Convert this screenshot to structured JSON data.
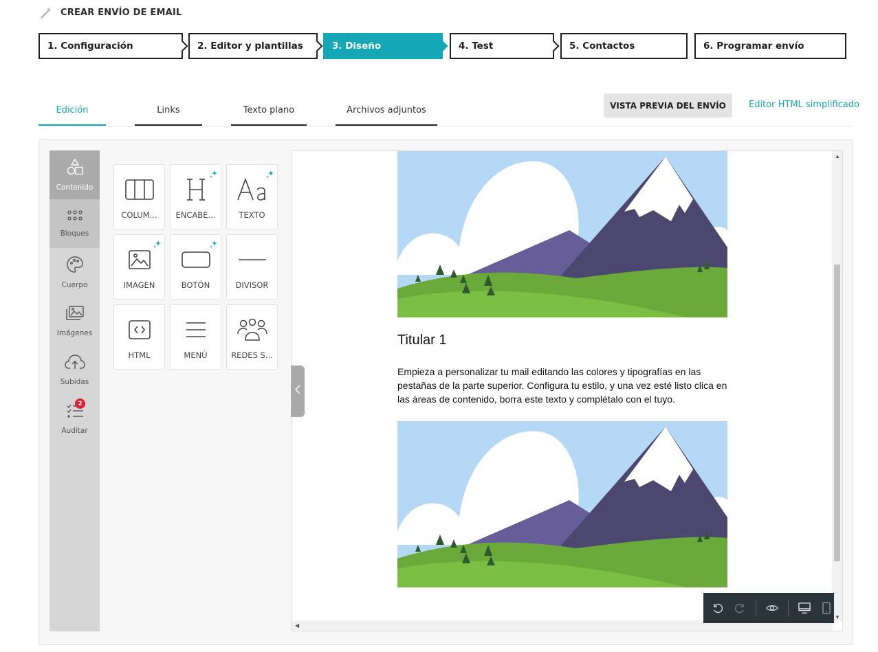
{
  "header": {
    "title": "CREAR ENVÍO DE EMAIL",
    "icon": "magic-wand-icon"
  },
  "steps": [
    {
      "label": "1. Configuración",
      "active": false
    },
    {
      "label": "2. Editor y plantillas",
      "active": false
    },
    {
      "label": "3. Diseño",
      "active": true
    },
    {
      "label": "4. Test",
      "active": false
    },
    {
      "label": "5. Contactos",
      "active": false
    },
    {
      "label": "6. Programar envío",
      "active": false
    }
  ],
  "tabs": [
    {
      "label": "Edición",
      "active": true
    },
    {
      "label": "Links",
      "active": false
    },
    {
      "label": "Texto plano",
      "active": false
    },
    {
      "label": "Archivos adjuntos",
      "active": false
    }
  ],
  "actions": {
    "preview_label": "VISTA PREVIA DEL ENVÍO",
    "html_editor_label": "Editor HTML simplificado"
  },
  "sidebar": {
    "items": [
      {
        "label": "Contenido",
        "icon": "shapes-icon"
      },
      {
        "label": "Bloques",
        "icon": "grid-dots-icon"
      },
      {
        "label": "Cuerpo",
        "icon": "palette-icon"
      },
      {
        "label": "Imágenes",
        "icon": "images-icon"
      },
      {
        "label": "Subidas",
        "icon": "cloud-upload-icon"
      },
      {
        "label": "Auditar",
        "icon": "checklist-icon",
        "badge": "2"
      }
    ]
  },
  "blocks": [
    {
      "label": "COLUM...",
      "icon": "columns-icon",
      "sparkle": false
    },
    {
      "label": "ENCABE...",
      "icon": "heading-icon",
      "sparkle": true
    },
    {
      "label": "TEXTO",
      "icon": "text-icon",
      "sparkle": true
    },
    {
      "label": "IMAGEN",
      "icon": "image-icon",
      "sparkle": true
    },
    {
      "label": "BOTÓN",
      "icon": "button-icon",
      "sparkle": true
    },
    {
      "label": "DIVISOR",
      "icon": "divider-icon",
      "sparkle": false
    },
    {
      "label": "HTML",
      "icon": "html-icon",
      "sparkle": false
    },
    {
      "label": "MENÚ",
      "icon": "menu-icon",
      "sparkle": false
    },
    {
      "label": "REDES S...",
      "icon": "social-icon",
      "sparkle": false
    }
  ],
  "email": {
    "heading": "Titular 1",
    "body": "Empieza a personalizar tu mail editando las colores y tipografías en las pestañas de la parte superior. Configura tu estilo, y una vez esté listo clica en las áreas de contenido, borra este texto y complétalo con el tuyo."
  },
  "colors": {
    "accent": "#14a7b5",
    "sky": "#b6d8f7",
    "mountain": "#4b476f",
    "grass": "#6db33f",
    "badge": "#e3202e"
  }
}
